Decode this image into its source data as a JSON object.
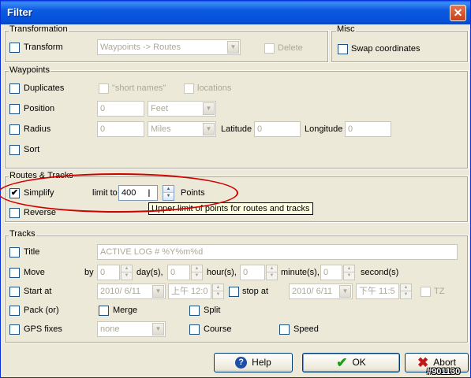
{
  "window": {
    "title": "Filter"
  },
  "transformation": {
    "group_label": "Transformation",
    "transform_label": "Transform",
    "transform_value": "Waypoints -> Routes",
    "delete_label": "Delete"
  },
  "misc": {
    "group_label": "Misc",
    "swap_label": "Swap coordinates"
  },
  "waypoints": {
    "group_label": "Waypoints",
    "duplicates_label": "Duplicates",
    "short_names_label": "\"short names\"",
    "locations_label": "locations",
    "position_label": "Position",
    "position_value": "0",
    "position_unit": "Feet",
    "radius_label": "Radius",
    "radius_value": "0",
    "radius_unit": "Miles",
    "latitude_label": "Latitude",
    "latitude_value": "0",
    "longitude_label": "Longitude",
    "longitude_value": "0",
    "sort_label": "Sort"
  },
  "routes_tracks": {
    "group_label": "Routes & Tracks",
    "simplify_label": "Simplify",
    "simplify_checked": "✔",
    "limit_label": "limit to",
    "limit_value": "400",
    "points_label": "Points",
    "reverse_label": "Reverse",
    "tooltip": "Upper limit of points for routes and tracks"
  },
  "tracks": {
    "group_label": "Tracks",
    "title_label": "Title",
    "title_value": "ACTIVE LOG # %Y%m%d",
    "move_label": "Move",
    "by_label": "by",
    "days_value": "0",
    "days_label": "day(s),",
    "hours_value": "0",
    "hours_label": "hour(s),",
    "minutes_value": "0",
    "minutes_label": "minute(s),",
    "seconds_value": "0",
    "seconds_label": "second(s)",
    "start_label": "Start at",
    "start_date": "2010/ 6/11",
    "start_time": "上午 12:0",
    "stop_label": "stop at",
    "stop_date": "2010/ 6/11",
    "stop_time": "下午 11:5",
    "tz_label": "TZ",
    "pack_label": "Pack (or)",
    "merge_label": "Merge",
    "split_label": "Split",
    "gps_label": "GPS fixes",
    "gps_value": "none",
    "course_label": "Course",
    "speed_label": "Speed"
  },
  "buttons": {
    "help": "Help",
    "ok": "OK",
    "abort": "Abort"
  },
  "watermark": "#901130",
  "colors": {
    "title_bar": "#0a5fe9",
    "annotation": "#d00000",
    "ok_icon": "#1a9c1a",
    "abort_icon": "#c01818",
    "help_icon": "#1c4fa8"
  }
}
